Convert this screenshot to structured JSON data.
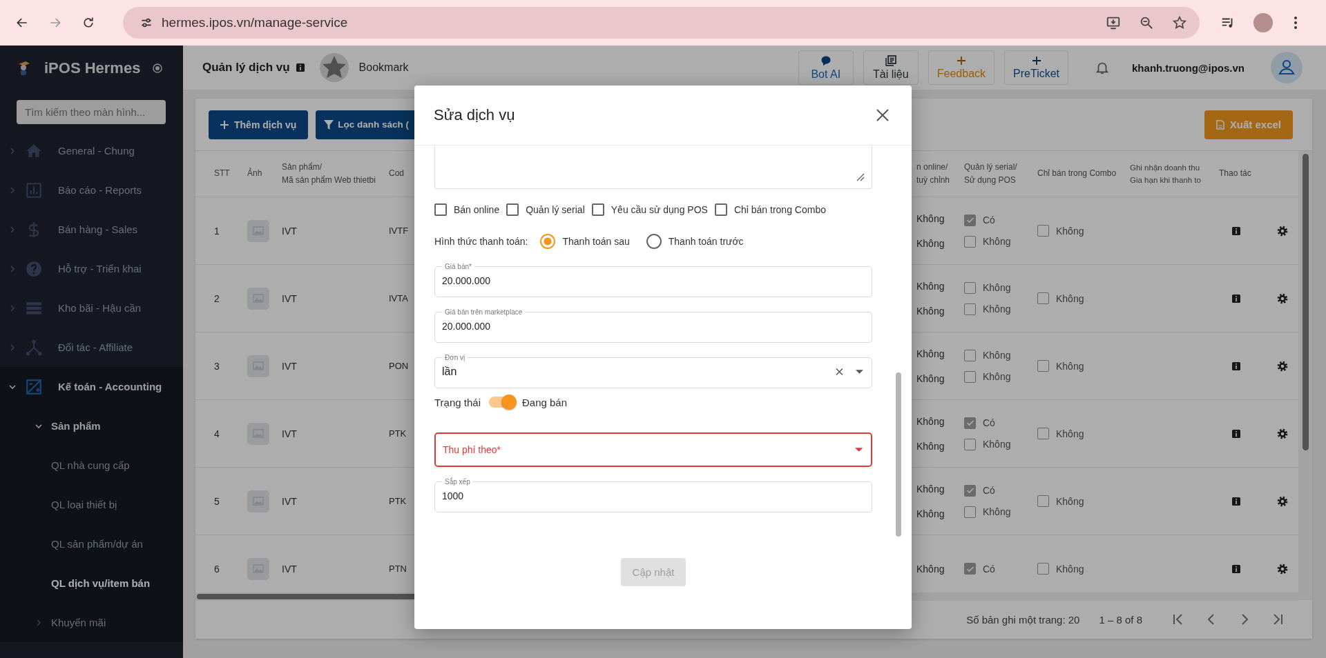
{
  "browser": {
    "url": "hermes.ipos.vn/manage-service"
  },
  "sidebar": {
    "brand": "iPOS Hermes",
    "search_placeholder": "Tìm kiếm theo màn hình...",
    "items": [
      {
        "label": "General - Chung",
        "expanded": false
      },
      {
        "label": "Báo cáo - Reports",
        "expanded": false
      },
      {
        "label": "Bán hàng - Sales",
        "expanded": false
      },
      {
        "label": "Hỗ trợ - Triển khai",
        "expanded": false
      },
      {
        "label": "Kho bãi - Hậu cần",
        "expanded": false
      },
      {
        "label": "Đối tác - Affiliate",
        "expanded": false
      },
      {
        "label": "Kế toán - Accounting",
        "expanded": true,
        "children": [
          {
            "label": "Sản phẩm",
            "expanded": true,
            "children": [
              {
                "label": "QL nhà cung cấp",
                "selected": false
              },
              {
                "label": "QL loại thiết bị",
                "selected": false
              },
              {
                "label": "QL sản phẩm/dự án",
                "selected": false
              },
              {
                "label": "QL dịch vụ/item bán",
                "selected": true
              }
            ]
          },
          {
            "label": "Khuyến mãi",
            "expanded": false
          }
        ]
      }
    ]
  },
  "header": {
    "title": "Quản lý dịch vụ",
    "bookmark": "Bookmark",
    "user": "khanh.truong@ipos.vn",
    "actions": [
      {
        "label": "Bot AI",
        "color": "#0e4583"
      },
      {
        "label": "Tài liệu",
        "color": "#1a2226"
      },
      {
        "label": "Feedback",
        "color": "#985e00"
      },
      {
        "label": "PreTicket",
        "color": "#093663"
      }
    ]
  },
  "toolbar": {
    "add_button": "Thêm dịch vụ",
    "filter_button": "Lọc danh sách (",
    "export_button": "Xuất excel"
  },
  "table": {
    "columns": [
      "STT",
      "Ảnh",
      "Sản phẩm/\nMã sản phẩm Web thietbi",
      "Cod",
      "n online/\ntuỳ chỉnh",
      "Quản lý serial/\nSử dụng POS",
      "Chỉ bán trong Combo",
      "Ghi nhận doanh thu\nGia hạn khi thanh to",
      "Thao tác"
    ],
    "rows": [
      {
        "stt": "1",
        "product": "IVT",
        "code": "IVTF",
        "online": [
          "Không",
          "Không"
        ],
        "serial": [
          {
            "label": "Có",
            "checked": true
          },
          {
            "label": "Không",
            "checked": false
          }
        ],
        "combo": {
          "label": "Không",
          "checked": false
        }
      },
      {
        "stt": "2",
        "product": "IVT",
        "code": "IVTA",
        "online": [
          "Không",
          "Không"
        ],
        "serial": [
          {
            "label": "Không",
            "checked": false
          },
          {
            "label": "Không",
            "checked": false
          }
        ],
        "combo": {
          "label": "Không",
          "checked": false
        }
      },
      {
        "stt": "3",
        "product": "IVT",
        "code": "PON",
        "online": [
          "Không",
          "Không"
        ],
        "serial": [
          {
            "label": "Không",
            "checked": false
          },
          {
            "label": "Không",
            "checked": false
          }
        ],
        "combo": {
          "label": "Không",
          "checked": false
        }
      },
      {
        "stt": "4",
        "product": "IVT",
        "code": "PTK",
        "online": [
          "Không",
          "Không"
        ],
        "serial": [
          {
            "label": "Có",
            "checked": true
          },
          {
            "label": "Không",
            "checked": false
          }
        ],
        "combo": {
          "label": "Không",
          "checked": false
        }
      },
      {
        "stt": "5",
        "product": "IVT",
        "code": "PTK",
        "online": [
          "Không",
          "Không"
        ],
        "serial": [
          {
            "label": "Có",
            "checked": true
          },
          {
            "label": "Không",
            "checked": false
          }
        ],
        "combo": {
          "label": "Không",
          "checked": false
        }
      },
      {
        "stt": "6",
        "product": "IVT",
        "code": "PTN",
        "online": [
          "Không"
        ],
        "serial": [
          {
            "label": "Có",
            "checked": true
          }
        ],
        "combo": {
          "label": "Không",
          "checked": false
        }
      }
    ]
  },
  "pagination": {
    "rows_per_page": "Số bản ghi một trang: 20",
    "range": "1 – 8 of 8"
  },
  "modal": {
    "title": "Sửa dịch vụ",
    "checkboxes": [
      {
        "label": "Bán online",
        "checked": false
      },
      {
        "label": "Quản lý serial",
        "checked": false
      },
      {
        "label": "Yêu cầu sử dụng POS",
        "checked": false
      },
      {
        "label": "Chỉ bán trong Combo",
        "checked": false
      }
    ],
    "payment": {
      "label": "Hình thức thanh toán:",
      "options": [
        {
          "label": "Thanh toán sau",
          "selected": true
        },
        {
          "label": "Thanh toán trước",
          "selected": false
        }
      ]
    },
    "fields": [
      {
        "kind": "text",
        "label": "Giá bán*",
        "value": "20.000.000"
      },
      {
        "kind": "text",
        "label": "Giá bán trên marketplace",
        "value": "20.000.000"
      },
      {
        "kind": "select",
        "label": "Đơn vị",
        "value": "lần",
        "clearable": true,
        "error": false
      },
      {
        "kind": "switch",
        "label": "Trạng thái",
        "on": true,
        "text": "Đang bán"
      },
      {
        "kind": "select",
        "placeholder": "Thu phí theo*",
        "clearable": false,
        "error": true
      },
      {
        "kind": "text",
        "label": "Sắp xếp",
        "value": "1000"
      }
    ],
    "button": {
      "label": "Cập nhật",
      "disabled": true
    }
  }
}
